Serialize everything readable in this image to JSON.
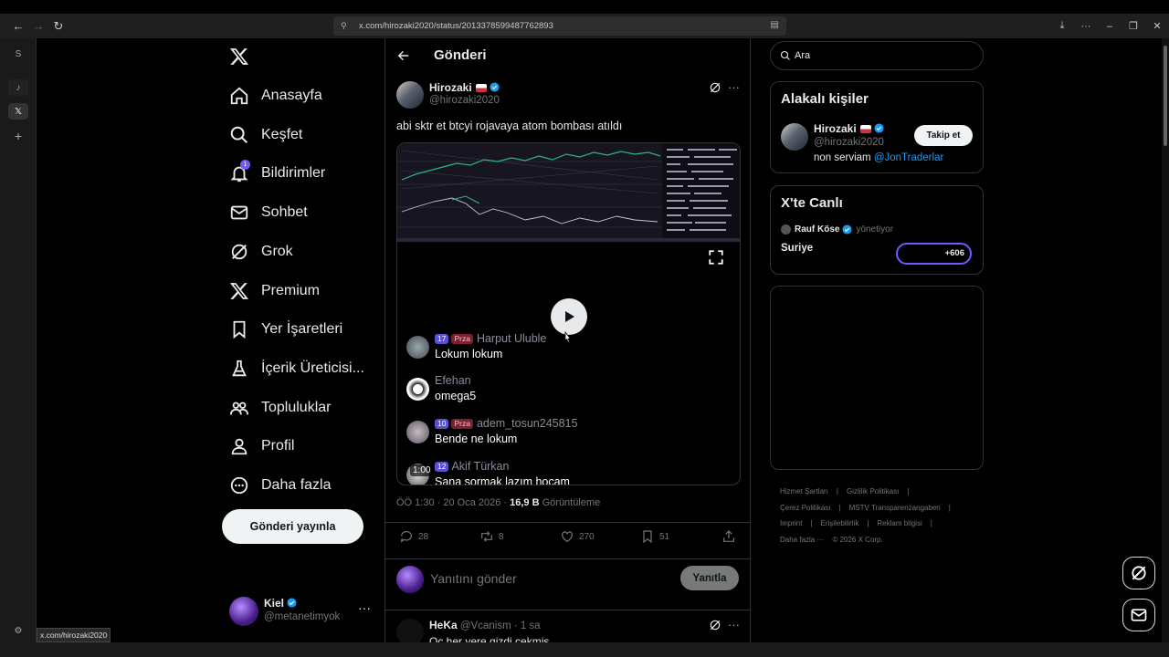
{
  "browser": {
    "url": "x.com/hirozaki2020/status/2013378599487762893",
    "status_url": "x.com/hirozaki2020",
    "rail_top_label": "S"
  },
  "nav": {
    "items": [
      {
        "label": "Anasayfa",
        "icon": "home-icon"
      },
      {
        "label": "Keşfet",
        "icon": "search-icon"
      },
      {
        "label": "Bildirimler",
        "icon": "bell-icon",
        "badge": "1"
      },
      {
        "label": "Sohbet",
        "icon": "mail-icon"
      },
      {
        "label": "Grok",
        "icon": "grok-icon"
      },
      {
        "label": "Premium",
        "icon": "x-logo-icon"
      },
      {
        "label": "Yer İşaretleri",
        "icon": "bookmark-icon"
      },
      {
        "label": "İçerik Üreticisi...",
        "icon": "flask-icon"
      },
      {
        "label": "Topluluklar",
        "icon": "people-icon"
      },
      {
        "label": "Profil",
        "icon": "person-icon"
      },
      {
        "label": "Daha fazla",
        "icon": "more-circle-icon"
      }
    ],
    "post_button": "Gönderi yayınla",
    "me": {
      "name": "Kiel",
      "handle": "@metanetimyok",
      "more": "···"
    }
  },
  "main": {
    "title": "Gönderi",
    "post": {
      "name": "Hirozaki",
      "handle": "@hirozaki2020",
      "more": "···",
      "text": "abi sktr et btcyi rojavaya atom bombası atıldı",
      "video_timestamp": "1:00",
      "comments": [
        {
          "level": "17",
          "badge": "Prza",
          "user": "Harput Ulubl​e",
          "message": "Lokum lokum"
        },
        {
          "level": "",
          "badge": "",
          "user": "Efehan",
          "message": "omega5"
        },
        {
          "level": "10",
          "badge": "Prza",
          "user": "adem_tosun245815",
          "message": "Bende ne lokum"
        },
        {
          "level": "12",
          "badge": "",
          "user": "Akif Türkan",
          "message": "Sana sormak lazım hocam"
        }
      ],
      "time": "ÖÖ 1:30 · 20 Oca 2026 · ",
      "views": "16,9 B",
      "views_label": " Görüntüleme",
      "stats": {
        "replies": "28",
        "reposts": "8",
        "likes": "270",
        "bookmarks": "51"
      }
    },
    "reply": {
      "placeholder": "Yanıtını gönder",
      "button": "Yanıtla"
    },
    "next_reply": {
      "name": "HeKa",
      "meta": " @Vcanism · 1 sa",
      "more": "···",
      "text": "Oc her yere gizdi cekmis"
    }
  },
  "right": {
    "search_placeholder": "Ara",
    "relevant": {
      "title": "Alakalı kişiler",
      "name": "Hirozaki",
      "handle": "@hirozaki2020",
      "bio": "non serviam ",
      "bio_link": "@JonTraderlar",
      "follow": "Takip et"
    },
    "live": {
      "title": "X'te Canlı",
      "host": "Rauf Köse",
      "role": "yönetiyor",
      "space": "Suriye",
      "listeners": "+606"
    },
    "footer": [
      "Hizmet Şartları",
      "|",
      "Gizlilik Politikası",
      "|",
      "Çerez Politikası",
      "|",
      "MSTV Transparenzangaben",
      "|",
      "Imprint",
      "|",
      "Erişilebilirlik",
      "|",
      "Reklam bilgisi",
      "|",
      "Daha fazla ···",
      "© 2026 X Corp."
    ]
  },
  "colors": {
    "accent": "#1d9bf0",
    "badge": "#7856ff",
    "background": "#000000",
    "border": "#2f3336"
  }
}
